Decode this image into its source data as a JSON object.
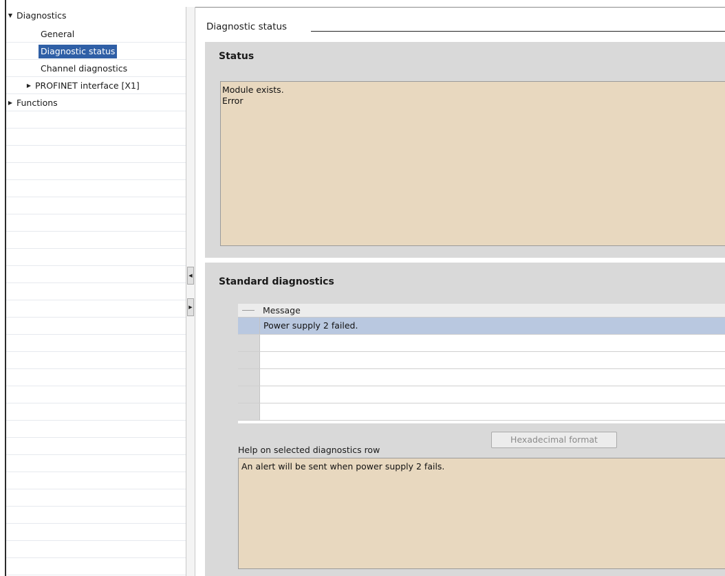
{
  "nav": {
    "items": [
      {
        "label": "Diagnostics",
        "expander": "expanded",
        "level": 0,
        "selected": false
      },
      {
        "label": "General",
        "expander": "none",
        "level": 1,
        "selected": false
      },
      {
        "label": "Diagnostic status",
        "expander": "none",
        "level": 1,
        "selected": true
      },
      {
        "label": "Channel diagnostics",
        "expander": "none",
        "level": 1,
        "selected": false
      },
      {
        "label": "PROFINET interface [X1]",
        "expander": "collapsed",
        "level": 1,
        "selected": false
      },
      {
        "label": "Functions",
        "expander": "collapsed",
        "level": 0,
        "selected": false
      }
    ]
  },
  "content": {
    "section_title": "Diagnostic status",
    "status_panel": {
      "title": "Status",
      "text_lines": [
        "Module exists.",
        "Error"
      ]
    },
    "standard_diagnostics": {
      "title": "Standard diagnostics",
      "table": {
        "column_header": "Message",
        "rows": [
          "Power supply 2 failed.",
          "",
          "",
          "",
          "",
          ""
        ],
        "selected_row": 0
      },
      "hex_button_label": "Hexadecimal format",
      "help_label": "Help on selected diagnostics row",
      "help_text": "An alert will be sent when power supply 2 fails."
    }
  },
  "colors": {
    "selection": "#2f5fa6",
    "row_selection": "#b9c8e0",
    "text_box_bg": "#e8d8bf",
    "panel_bg": "#d9d9d9"
  }
}
